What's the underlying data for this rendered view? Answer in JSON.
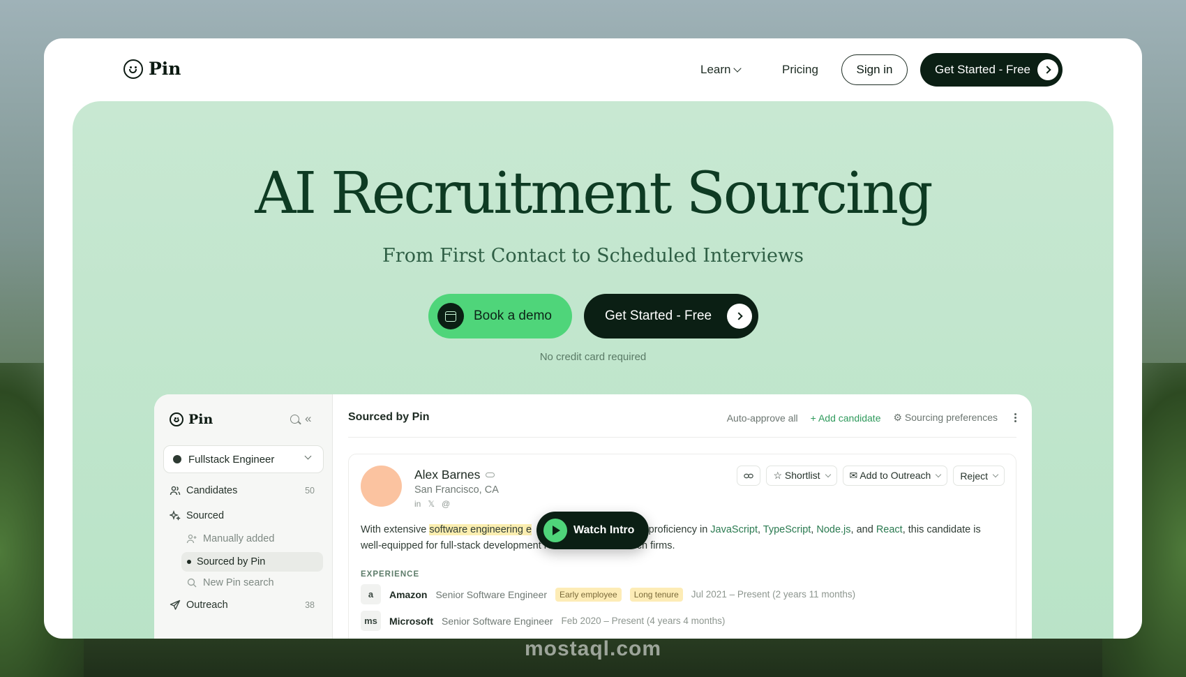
{
  "nav": {
    "logo_text": "Pin",
    "learn": "Learn",
    "pricing": "Pricing",
    "sign_in": "Sign in",
    "get_started": "Get Started - Free"
  },
  "hero": {
    "title": "AI Recruitment Sourcing",
    "subtitle": "From First Contact to Scheduled Interviews",
    "book_demo": "Book a demo",
    "get_started": "Get Started - Free",
    "no_credit": "No credit card required"
  },
  "app": {
    "sidebar": {
      "logo_text": "Pin",
      "collapse_glyph": "«",
      "role": "Fullstack Engineer",
      "items": [
        {
          "label": "Candidates",
          "count": "50"
        },
        {
          "label": "Sourced",
          "count": ""
        },
        {
          "label": "Outreach",
          "count": "38"
        }
      ],
      "sub_items": [
        {
          "label": "Manually added"
        },
        {
          "label": "Sourced by Pin"
        },
        {
          "label": "New Pin search"
        }
      ]
    },
    "main": {
      "title": "Sourced by Pin",
      "auto_approve": "Auto-approve all",
      "add_candidate": "+ Add candidate",
      "sourcing_prefs": "⚙ Sourcing preferences"
    },
    "candidate": {
      "name": "Alex Barnes",
      "location": "San Francisco, CA",
      "socials": [
        "in",
        "𝕏",
        "@"
      ],
      "buttons": {
        "shortlist": "☆ Shortlist",
        "add_outreach": "✉ Add to Outreach",
        "reject": "Reject"
      },
      "desc_pre": "With extensive ",
      "desc_hl": "software engineering e",
      "desc_mid": "                      d Microsoft, proficiency in ",
      "skills": [
        "JavaScript",
        "TypeScript",
        "Node.js",
        "React"
      ],
      "desc_post": ", this candidate is well-equipped for full-stack development roles at innovative tech firms.",
      "experience_label": "EXPERIENCE",
      "experience": [
        {
          "logo": "a",
          "company": "Amazon",
          "title": "Senior Software Engineer",
          "tags": [
            "Early employee",
            "Long tenure"
          ],
          "dates": "Jul 2021 – Present (2 years 11 months)"
        },
        {
          "logo": "ms",
          "company": "Microsoft",
          "title": "Senior Software Engineer",
          "tags": [],
          "dates": "Feb 2020 – Present (4 years 4 months)"
        }
      ]
    }
  },
  "watch_intro": "Watch Intro",
  "watermark": "mostaql.com",
  "colors": {
    "brand_dark": "#0b1f14",
    "brand_green": "#4fd57a",
    "hero_bg": "#c8e8d2",
    "title_green": "#0e3b23"
  }
}
